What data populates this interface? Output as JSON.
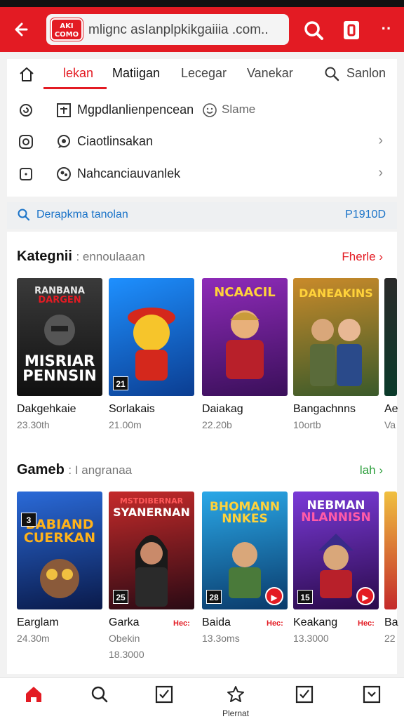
{
  "app": {
    "url": "mlignc asIanplpkikgaiiia .com..",
    "logo_text": "AKI\nCOMO"
  },
  "tabs": [
    {
      "label": "lekan"
    },
    {
      "label": "Matiigan"
    },
    {
      "label": "Lecegar"
    },
    {
      "label": "Vanekar"
    },
    {
      "label": "Sanlon"
    }
  ],
  "menu": {
    "row1": {
      "label": "Mgpdlanlienpencean",
      "extra": "Slame"
    },
    "row2": {
      "label": "Ciaotlinsakan"
    },
    "row3": {
      "label": "Nahcanciauvanlek"
    }
  },
  "promo": {
    "text": "Derapkma tanolan",
    "code": "P1910D"
  },
  "section1": {
    "title": "Kategnii",
    "subtitle": ": ennoulaaan",
    "link": "Fherle",
    "items": [
      {
        "name": "Dakgehkaie",
        "meta": "23.30th",
        "art": "RANBANA DARGEN MISRIAR PENNSIN",
        "badge": ""
      },
      {
        "name": "Sorlakais",
        "meta": "21.00m",
        "art": "",
        "badge": "21"
      },
      {
        "name": "Daiakag",
        "meta": "22.20b",
        "art": "NCAACIL",
        "badge": ""
      },
      {
        "name": "Bangachnns",
        "meta": "10ortb",
        "art": "DANEAKINS",
        "badge": ""
      },
      {
        "name": "Ae",
        "meta": "Va",
        "art": "",
        "badge": ""
      }
    ]
  },
  "section2": {
    "title": "Gameb",
    "subtitle": ": I angranaa",
    "link": "lah",
    "items": [
      {
        "name": "Earglam",
        "meta": "24.30m",
        "meta2": "",
        "art": "BABIAND CUERKAN",
        "badge": "",
        "tag": ""
      },
      {
        "name": "Garka",
        "meta": "Obekin",
        "meta2": "18.3000",
        "art": "MSTDIBERNAR SYANERNAN",
        "badge": "25",
        "tag": "Hec:"
      },
      {
        "name": "Baida",
        "meta": "13.3oms",
        "meta2": "",
        "art": "BHOMANN NNKES",
        "badge": "28",
        "tag": "Hec:"
      },
      {
        "name": "Keakang",
        "meta": "13.3000",
        "meta2": "",
        "art": "NEBMAN NLANNISN",
        "badge": "15",
        "tag": "Hec:"
      },
      {
        "name": "Ba",
        "meta": "22",
        "meta2": "",
        "art": "",
        "badge": "",
        "tag": ""
      }
    ]
  },
  "bottom_nav": [
    {
      "icon": "home-icon",
      "label": ""
    },
    {
      "icon": "search-icon",
      "label": ""
    },
    {
      "icon": "checkbox-icon",
      "label": ""
    },
    {
      "icon": "puzzle-icon",
      "label": "Plernat"
    },
    {
      "icon": "checkbox-icon",
      "label": ""
    },
    {
      "icon": "checkbox-icon",
      "label": ""
    }
  ],
  "colors": {
    "brand": "#e31b23",
    "link": "#1a73c8",
    "green": "#2a9d3a"
  }
}
